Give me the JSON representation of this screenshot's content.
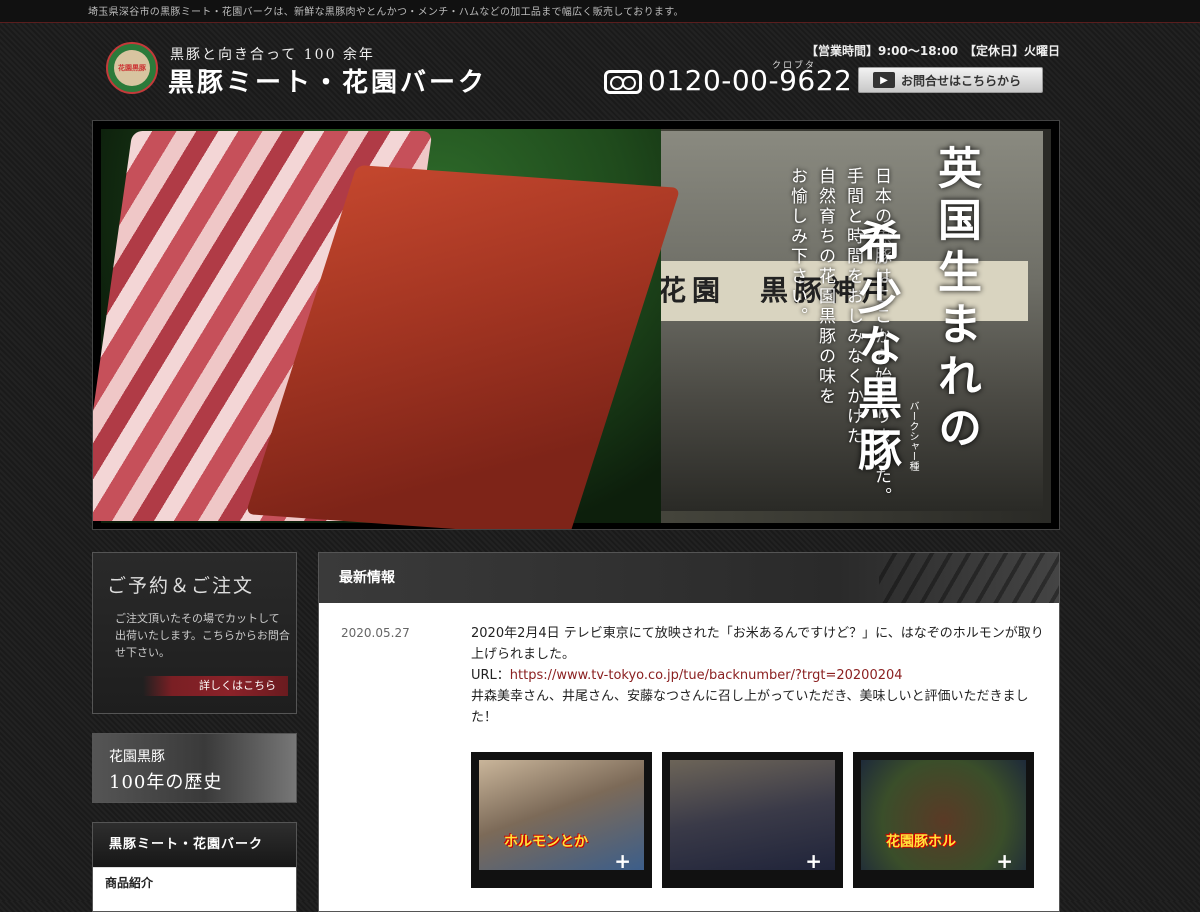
{
  "topbar": {
    "text": "埼玉県深谷市の黒豚ミート・花園バークは、新鮮な黒豚肉やとんかつ・メンチ・ハムなどの加工品まで幅広く販売しております。"
  },
  "header": {
    "emblem_text": "花園黒豚",
    "tagline": "黒豚と向き合って 100 余年",
    "brand": "黒豚ミート・花園バーク",
    "hours": "【営業時間】9:00〜18:00　【定休日】火曜日",
    "phone_ruby": "クロブタ",
    "phone": "0120-00-9622",
    "contact_label": "お問合せはこちらから",
    "contact_arrow": "▶"
  },
  "hero": {
    "shop_sign": "花園　黒豚神戸",
    "big_line1": "英国生まれの",
    "big_line2": "希少な黒豚",
    "ruby": "バークシャー種",
    "copy": [
      "日本の黒豚はここから始まりました。",
      "手間と時間をおしみなくかけた",
      "自然育ちの花園黒豚の味を",
      "お愉しみ下さい。"
    ]
  },
  "sidebar": {
    "order_title": "ご予約＆ご注文",
    "order_desc": "ご注文頂いたその場でカットして出荷いたします。こちらからお問合せ下さい。",
    "order_more": "詳しくはこちら",
    "history_l1": "花園黒豚",
    "history_l2": "100年の歴史",
    "nav_head": "黒豚ミート・花園バーク",
    "nav_items": [
      "商品紹介"
    ]
  },
  "news": {
    "heading": "最新情報",
    "date": "2020.05.27",
    "line1": "2020年2月4日 テレビ東京にて放映された「お米あるんですけど？」に、はなぞのホルモンが取り上げられました。",
    "url_label": "URL：",
    "url": "https://www.tv-tokyo.co.jp/tue/backnumber/?trgt=20200204",
    "line2": "井森美幸さん、井尾さん、安藤なつさんに召し上がっていただき、美味しいと評価いただきました！",
    "thumbs": [
      {
        "caption": "ホルモンとか",
        "plus": "+"
      },
      {
        "caption": "",
        "plus": "+"
      },
      {
        "caption": "花園豚ホル",
        "plus": "+"
      }
    ]
  }
}
